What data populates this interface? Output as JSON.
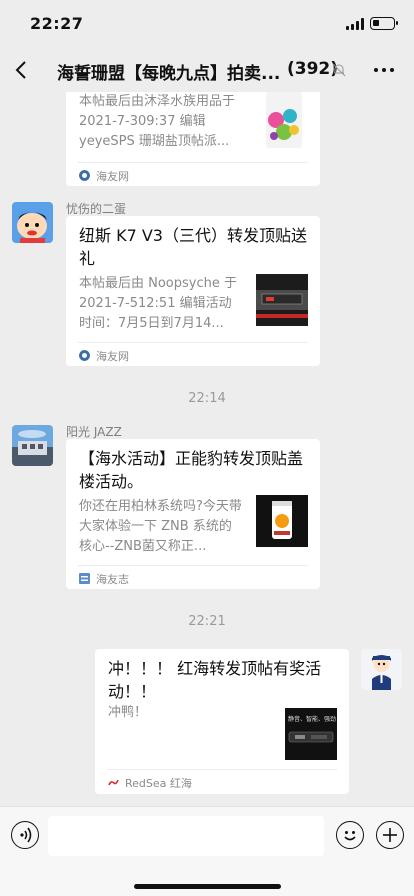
{
  "status_bar": {
    "time": "22:27",
    "battery_level": 0.3
  },
  "nav": {
    "title": "海誓珊盟【每晚九点】拍卖...",
    "member_count": "(392)",
    "back_icon": "chevron-left-icon",
    "mute_icon": "mute-bell-icon",
    "more_icon": "more-dots-icon"
  },
  "messages": [
    {
      "type": "card",
      "from": "other",
      "sender": "",
      "title": "",
      "desc": "本帖最后由沐泽水族用品于 2021-7-309:37 编辑 yeyeSPS 珊瑚盐顶帖派...",
      "source": "海友网"
    },
    {
      "type": "card",
      "from": "other",
      "sender": "忧伤的二蛋",
      "title": "纽斯 K7 V3（三代）转发顶贴送礼",
      "desc": "本帖最后由 Noopsyche 于 2021-7-512:51 编辑活动时间：7月5日到7月14...",
      "source": "海友网"
    },
    {
      "type": "time",
      "text": "22:14"
    },
    {
      "type": "card",
      "from": "other",
      "sender": "阳光 JAZZ",
      "title": "【海水活动】正能豹转发顶贴盖楼活动。",
      "desc": "你还在用柏林系统吗?今天带大家体验一下 ZNB 系统的核心--ZNB菌又称正...",
      "source": "海友志"
    },
    {
      "type": "time",
      "text": "22:21"
    },
    {
      "type": "card",
      "from": "me",
      "sender": "",
      "title": "冲！！！ 红海转发顶帖有奖活动！！",
      "desc": "冲鸭！",
      "source": "RedSea 红海",
      "thumb_text": "静音、智能、强劲"
    }
  ],
  "input_bar": {
    "voice_icon": "voice-icon",
    "emoji_icon": "emoji-icon",
    "plus_icon": "plus-icon",
    "input_value": ""
  }
}
